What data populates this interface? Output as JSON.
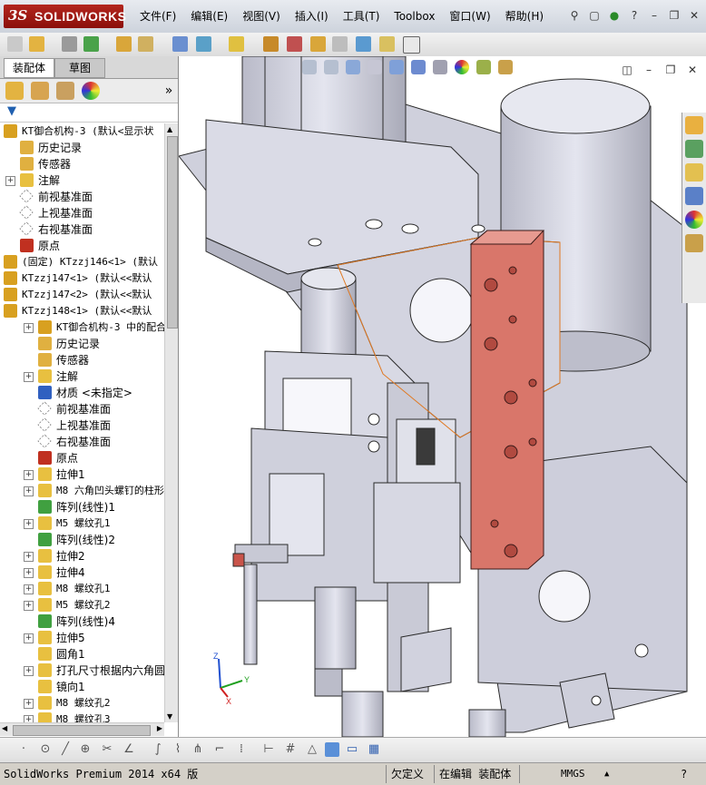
{
  "app": {
    "logo_ds": "3S",
    "logo_name": "SOLIDWORKS",
    "menu": [
      "文件(F)",
      "编辑(E)",
      "视图(V)",
      "插入(I)",
      "工具(T)",
      "Toolbox",
      "窗口(W)",
      "帮助(H)"
    ]
  },
  "panel": {
    "tab_assembly": "装配体",
    "tab_sketch": "草图",
    "tree": [
      {
        "indent": 0,
        "expand": "-",
        "icon": "assembly-icon",
        "color": "#d8a020",
        "label": "KT御合机构-3  (默认<显示状",
        "mono": true
      },
      {
        "indent": 1,
        "expand": "",
        "icon": "history-icon",
        "color": "#e0b040",
        "label": "历史记录"
      },
      {
        "indent": 1,
        "expand": "",
        "icon": "sensor-icon",
        "color": "#e0b040",
        "label": "传感器"
      },
      {
        "indent": 1,
        "expand": "+",
        "icon": "annotation-icon",
        "color": "#e8c040",
        "label": "注解"
      },
      {
        "indent": 1,
        "expand": "",
        "icon": "plane-icon",
        "color": "#ffffff",
        "label": "前视基准面"
      },
      {
        "indent": 1,
        "expand": "",
        "icon": "plane-icon",
        "color": "#ffffff",
        "label": "上视基准面"
      },
      {
        "indent": 1,
        "expand": "",
        "icon": "plane-icon",
        "color": "#ffffff",
        "label": "右视基准面"
      },
      {
        "indent": 1,
        "expand": "",
        "icon": "origin-icon",
        "color": "#c03020",
        "label": "原点"
      },
      {
        "indent": 0,
        "expand": "+",
        "icon": "part-icon",
        "color": "#d8a020",
        "label": "(固定) KTzzj146<1> (默认",
        "mono": true
      },
      {
        "indent": 0,
        "expand": "+",
        "icon": "part-icon",
        "color": "#d8a020",
        "label": "KTzzj147<1> (默认<<默认",
        "mono": true
      },
      {
        "indent": 0,
        "expand": "+",
        "icon": "part-icon",
        "color": "#d8a020",
        "label": "KTzzj147<2> (默认<<默认",
        "mono": true
      },
      {
        "indent": 0,
        "expand": "-",
        "icon": "part-icon",
        "color": "#d8a020",
        "label": "KTzzj148<1> (默认<<默认",
        "mono": true
      },
      {
        "indent": 2,
        "expand": "+",
        "icon": "mate-icon",
        "color": "#d8a020",
        "label": "KT御合机构-3 中的配合",
        "mono": true
      },
      {
        "indent": 2,
        "expand": "",
        "icon": "history-icon",
        "color": "#e0b040",
        "label": "历史记录"
      },
      {
        "indent": 2,
        "expand": "",
        "icon": "sensor-icon",
        "color": "#e0b040",
        "label": "传感器"
      },
      {
        "indent": 2,
        "expand": "+",
        "icon": "annotation-icon",
        "color": "#e8c040",
        "label": "注解"
      },
      {
        "indent": 2,
        "expand": "",
        "icon": "material-icon",
        "color": "#3060c0",
        "label": "材质 <未指定>"
      },
      {
        "indent": 2,
        "expand": "",
        "icon": "plane-icon",
        "color": "#ffffff",
        "label": "前视基准面"
      },
      {
        "indent": 2,
        "expand": "",
        "icon": "plane-icon",
        "color": "#ffffff",
        "label": "上视基准面"
      },
      {
        "indent": 2,
        "expand": "",
        "icon": "plane-icon",
        "color": "#ffffff",
        "label": "右视基准面"
      },
      {
        "indent": 2,
        "expand": "",
        "icon": "origin-icon",
        "color": "#c03020",
        "label": "原点"
      },
      {
        "indent": 2,
        "expand": "+",
        "icon": "extrude-icon",
        "color": "#e8c040",
        "label": "拉伸1"
      },
      {
        "indent": 2,
        "expand": "+",
        "icon": "hole-icon",
        "color": "#e8c040",
        "label": "M8 六角凹头螺钉的柱形",
        "mono": true
      },
      {
        "indent": 2,
        "expand": "",
        "icon": "pattern-icon",
        "color": "#40a040",
        "label": "阵列(线性)1"
      },
      {
        "indent": 2,
        "expand": "+",
        "icon": "hole-icon",
        "color": "#e8c040",
        "label": "M5 螺纹孔1",
        "mono": true
      },
      {
        "indent": 2,
        "expand": "",
        "icon": "pattern-icon",
        "color": "#40a040",
        "label": "阵列(线性)2"
      },
      {
        "indent": 2,
        "expand": "+",
        "icon": "extrude-icon",
        "color": "#e8c040",
        "label": "拉伸2"
      },
      {
        "indent": 2,
        "expand": "+",
        "icon": "extrude-icon",
        "color": "#e8c040",
        "label": "拉伸4"
      },
      {
        "indent": 2,
        "expand": "+",
        "icon": "hole-icon",
        "color": "#e8c040",
        "label": "M8 螺纹孔1",
        "mono": true
      },
      {
        "indent": 2,
        "expand": "+",
        "icon": "hole-icon",
        "color": "#e8c040",
        "label": "M5 螺纹孔2",
        "mono": true
      },
      {
        "indent": 2,
        "expand": "",
        "icon": "pattern-icon",
        "color": "#40a040",
        "label": "阵列(线性)4"
      },
      {
        "indent": 2,
        "expand": "+",
        "icon": "extrude-icon",
        "color": "#e8c040",
        "label": "拉伸5"
      },
      {
        "indent": 2,
        "expand": "",
        "icon": "fillet-icon",
        "color": "#e8c040",
        "label": "圆角1"
      },
      {
        "indent": 2,
        "expand": "+",
        "icon": "hole-icon",
        "color": "#e8c040",
        "label": "打孔尺寸根据内六角圆"
      },
      {
        "indent": 2,
        "expand": "",
        "icon": "mirror-icon",
        "color": "#e8c040",
        "label": "镜向1"
      },
      {
        "indent": 2,
        "expand": "+",
        "icon": "hole-icon",
        "color": "#e8c040",
        "label": "M8 螺纹孔2",
        "mono": true
      },
      {
        "indent": 2,
        "expand": "+",
        "icon": "hole-icon",
        "color": "#e8c040",
        "label": "M8 螺纹孔3",
        "mono": true
      }
    ]
  },
  "triad": {
    "z": "Z",
    "y": "Y",
    "x": "X"
  },
  "colors": {
    "selected_face": "#d9766a",
    "part_gray": "#d6d7e3",
    "edge": "#2a2a2a"
  },
  "status": {
    "product": "SolidWorks Premium 2014 x64 版",
    "definition": "欠定义",
    "mode": "在编辑 装配体",
    "units": "MMGS"
  }
}
